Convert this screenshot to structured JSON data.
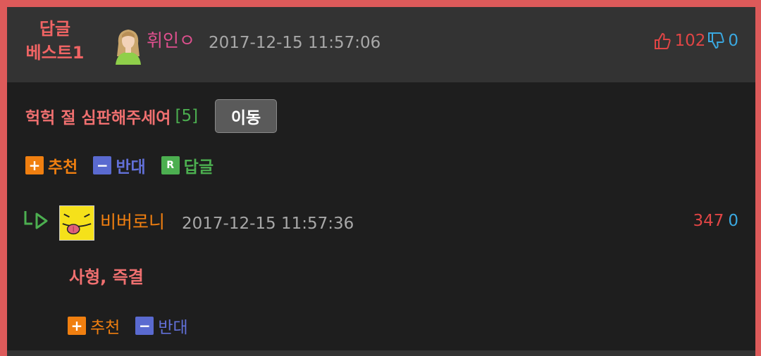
{
  "best_comment": {
    "badge_line1": "답글",
    "badge_line2": "베스트1",
    "author": "휘인ㅇ",
    "date": "2017-12-15 11:57:06",
    "up_count": "102",
    "down_count": "0",
    "post_title": "헉헉 절 심판해주세여",
    "comment_count": "[5]",
    "move_button": "이동",
    "actions": {
      "recommend": "추천",
      "oppose": "반대",
      "reply": "답글",
      "reply_box": "R"
    }
  },
  "reply": {
    "author": "비버로니",
    "date": "2017-12-15 11:57:36",
    "up_count": "347",
    "down_count": "0",
    "text": "사형, 즉결",
    "actions": {
      "recommend": "추천",
      "oppose": "반대"
    }
  },
  "colors": {
    "border": "#dd5a5a",
    "header_bg": "#333333",
    "body_bg": "#1e1e1e",
    "title": "#f07070",
    "recommend": "#f07f10",
    "oppose": "#5a6ad0",
    "reply": "#4caf50"
  }
}
